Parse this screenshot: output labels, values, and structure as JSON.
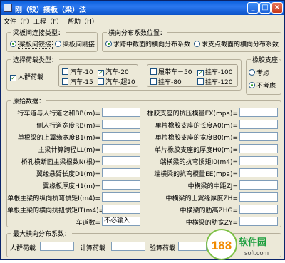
{
  "window": {
    "title": "刚（铰）接板（梁）法"
  },
  "menu": [
    "文件（F）",
    "工程（F）",
    "帮助（H）"
  ],
  "connection": {
    "legend": "梁板间连接类型：",
    "options": [
      "梁板间铰接",
      "梁板间刚接"
    ],
    "selected": 0
  },
  "position": {
    "legend": "横向分布系数位置：",
    "options": [
      "求跨中截面的横向分布系数",
      "求支点截面的横向分布系数"
    ],
    "selected": 0
  },
  "load": {
    "legend": "选择荷载类型：",
    "crowd": "人群荷载",
    "cars": [
      "汽车-10",
      "汽车-20",
      "汽车-15",
      "汽车-超20"
    ],
    "trailers": [
      "履带车－50",
      "挂车-100",
      "挂车-80",
      "挂车-120"
    ]
  },
  "bearing": {
    "legend": "橡胶支座",
    "options": [
      "考虑",
      "不考虑"
    ],
    "selected": 1
  },
  "raw": {
    "legend": "原始数据：",
    "left": [
      "行车道与人行道之和BB(m)=",
      "一侧人行道宽度RB(m)=",
      "单根梁的上翼缘宽度B1(m)=",
      "主梁计算跨径LL(m)=",
      "桥孔横断面主梁根数N(根)=",
      "翼缘悬臂长度D1(m)=",
      "翼缘板厚度H1(m)=",
      "单根主梁的纵向抗弯惯矩I(m4)=",
      "单根主梁的横向抗扭惯矩IT(m4)=",
      "车道数="
    ],
    "lanes_placeholder": "不必输入",
    "right": [
      "橡胶支座的抗压模量EX(mpa)=",
      "单片橡胶支座的长度A0(m)=",
      "单片橡胶支座的宽度B0(m)=",
      "单片橡胶支座的厚度H0(m)=",
      "端横梁的抗弯惯矩I0(m4)=",
      "端横梁的抗弯模量EE(mpa)=",
      "中横梁的中距ZJ=",
      "中横梁的上翼缘厚度ZH=",
      "中横梁的肋高ZHG=",
      "中横梁的肋宽ZY="
    ]
  },
  "max": {
    "legend": "最大横向分布系数：",
    "labels": [
      "人群荷载",
      "计算荷载",
      "验算荷载"
    ]
  },
  "watermark": {
    "brand": "软件园",
    "url": "soft.com",
    "logo": "188"
  },
  "colors": {
    "title": "#0a5fdc",
    "face": "#ece9d8"
  }
}
